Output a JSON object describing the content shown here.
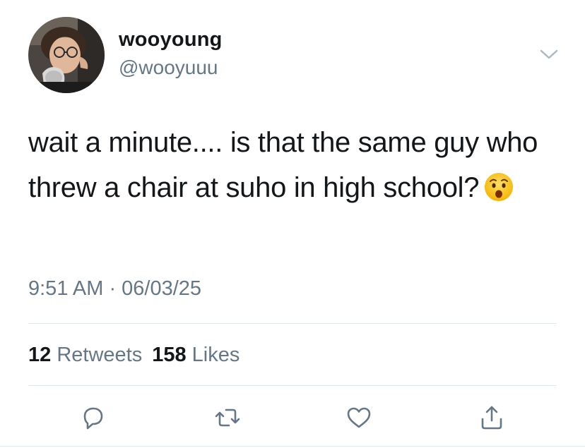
{
  "author": {
    "display_name": "wooyoung",
    "handle": "@wooyuuu"
  },
  "tweet": {
    "text": "wait a minute.... is that the same guy who threw a chair at suho in high school?",
    "emoji": "hushed-face",
    "timestamp": "9:51 AM · 06/03/25"
  },
  "stats": {
    "retweets_count": "12",
    "retweets_label": "Retweets",
    "likes_count": "158",
    "likes_label": "Likes"
  },
  "actions": {
    "reply_icon": "comment-icon",
    "retweet_icon": "retweet-icon",
    "like_icon": "heart-icon",
    "share_icon": "share-icon"
  },
  "colors": {
    "primary_text": "#14171a",
    "secondary_text": "#657786",
    "divider": "#e1e8ed"
  }
}
